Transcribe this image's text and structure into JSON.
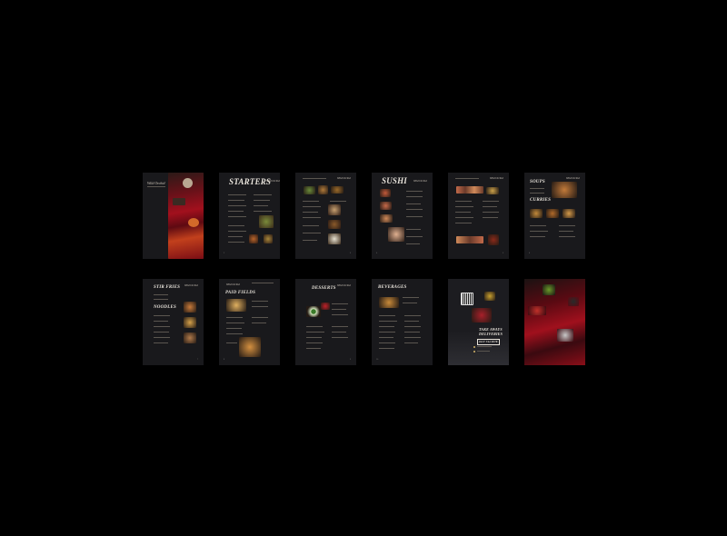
{
  "brand": {
    "logo": "Wild Orchid"
  },
  "page_titles": {
    "starters": "STARTERS",
    "sushi": "SUSHI",
    "soups": "SOUPS",
    "curries": "CURRIES",
    "stir_fries": "STIR FRIES",
    "noodles": "NOODLES",
    "paid_fields": "PAID FIELDS",
    "desserts": "DESSERTS",
    "beverages": "BEVERAGES",
    "take_away_1": "TAKE AWAYS",
    "take_away_2": "DELIVERIES",
    "phone": "0417 744 9078"
  },
  "colors": {
    "background": "#000000",
    "page": "#19191c",
    "accent_red": "#8e0d18",
    "text": "#e9e4dc"
  }
}
